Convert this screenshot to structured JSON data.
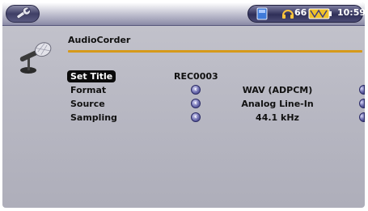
{
  "status": {
    "volume": "66",
    "time": "10:59"
  },
  "header": {
    "title": "AudioCorder"
  },
  "rows": [
    {
      "label": "Set Title",
      "value": "REC0003"
    },
    {
      "label": "Format",
      "value": "WAV (ADPCM)"
    },
    {
      "label": "Source",
      "value": "Analog Line-In"
    },
    {
      "label": "Sampling",
      "value": "44.1 kHz"
    }
  ],
  "icons": {
    "tools": "wrench-icon",
    "storage": "storage-icon",
    "headphones": "headphones-icon",
    "battery": "battery-icon",
    "microphone": "microphone-icon",
    "left": "chevron-left-icon",
    "right": "chevron-right-icon"
  },
  "colors": {
    "accent": "#d69a1a",
    "selected_bg": "#0b0b0b",
    "bar_dark": "#2f2f58"
  }
}
